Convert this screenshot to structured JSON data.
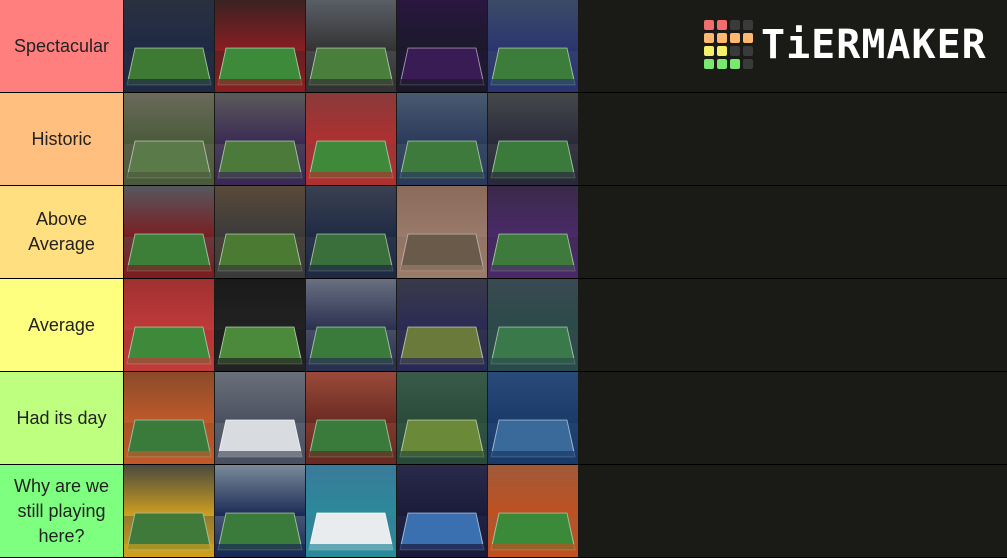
{
  "tiers": [
    {
      "label": "Spectacular",
      "color": "#ff7f7f",
      "items": 5
    },
    {
      "label": "Historic",
      "color": "#ffbf7f",
      "items": 5
    },
    {
      "label": "Above Average",
      "color": "#ffdf7f",
      "items": 5
    },
    {
      "label": "Average",
      "color": "#ffff7f",
      "items": 5
    },
    {
      "label": "Had its day",
      "color": "#bfff7f",
      "items": 5
    },
    {
      "label": "Why are we still playing here?",
      "color": "#7fff7f",
      "items": 5
    }
  ],
  "logo": {
    "text": "TiERMAKER",
    "grid": [
      "#f26d6d",
      "#f26d6d",
      "#3a3a3a",
      "#3a3a3a",
      "#ffb870",
      "#ffb870",
      "#ffb870",
      "#ffb870",
      "#f5f06a",
      "#f5f06a",
      "#3a3a3a",
      "#3a3a3a",
      "#78e86e",
      "#78e86e",
      "#78e86e",
      "#3a3a3a"
    ]
  },
  "tile_palettes": [
    [
      "#2a3040",
      "#3f7a35",
      "#1e2a44"
    ],
    [
      "#3b2222",
      "#3d8a3a",
      "#8a1e22"
    ],
    [
      "#5a5e66",
      "#4a7e3c",
      "#333"
    ],
    [
      "#2a1640",
      "#3a1c55",
      "#1a1a2a"
    ],
    [
      "#3c4a66",
      "#3d7d3b",
      "#2a3570"
    ],
    [
      "#6a6a5a",
      "#5a7a4a",
      "#4a5a3a"
    ],
    [
      "#5a5a5a",
      "#4b7a3a",
      "#3a2a55"
    ],
    [
      "#8a3a3a",
      "#3f8a3a",
      "#b03030"
    ],
    [
      "#4a5a70",
      "#3e7a3c",
      "#2a3a5a"
    ],
    [
      "#44484a",
      "#3a7a3a",
      "#2a2a3a"
    ],
    [
      "#55585e",
      "#3d7e39",
      "#7a1e22"
    ],
    [
      "#5a4a3a",
      "#4b7a33",
      "#3a3a3a"
    ],
    [
      "#3a4050",
      "#3a6e3a",
      "#1e2a44"
    ],
    [
      "#8a6a5a",
      "#6a5a4a",
      "#9a7a6a"
    ],
    [
      "#3a2a4a",
      "#3d7a3b",
      "#4a2a6a"
    ],
    [
      "#a03030",
      "#3e8a3a",
      "#c03a3a"
    ],
    [
      "#1a1a1a",
      "#4a8a3a",
      "#222"
    ],
    [
      "#6a7080",
      "#3a7a3a",
      "#2a3050"
    ],
    [
      "#3a3a4a",
      "#6a7a3a",
      "#2a2a55"
    ],
    [
      "#3a4a50",
      "#3a7a4a",
      "#2a4a4a"
    ],
    [
      "#8a4a2a",
      "#3a7a3a",
      "#c05a2a"
    ],
    [
      "#6a707a",
      "#d8dce0",
      "#4a5060"
    ],
    [
      "#9a4a3a",
      "#3a7a3a",
      "#6a2a22"
    ],
    [
      "#3a5a4a",
      "#6a8a3a",
      "#2a4a3a"
    ],
    [
      "#2a4a7a",
      "#3a6a9a",
      "#1a3a6a"
    ],
    [
      "#4a4a40",
      "#3f7a3a",
      "#d0a020"
    ],
    [
      "#7a8a9a",
      "#3a7a3a",
      "#1a2a55"
    ],
    [
      "#3a7a9a",
      "#e8ecee",
      "#2a8a9a"
    ],
    [
      "#2a2a4a",
      "#3a70b0",
      "#1a1a3a"
    ],
    [
      "#a05a3a",
      "#3a8a3a",
      "#c05020"
    ]
  ]
}
